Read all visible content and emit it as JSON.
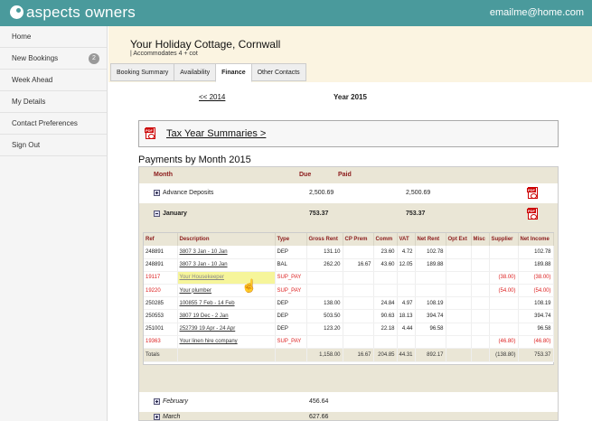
{
  "app": {
    "brand": "aspects owners",
    "user_email": "emailme@home.com"
  },
  "sidebar": {
    "items": [
      {
        "label": "Home"
      },
      {
        "label": "New Bookings",
        "badge": "2"
      },
      {
        "label": "Week Ahead"
      },
      {
        "label": "My Details"
      },
      {
        "label": "Contact Preferences"
      },
      {
        "label": "Sign Out"
      }
    ]
  },
  "property": {
    "title": "Your Holiday Cottage, Cornwall",
    "subtitle": "| Accommodates 4 + cot"
  },
  "tabs": [
    {
      "label": "Booking Summary"
    },
    {
      "label": "Availability"
    },
    {
      "label": "Finance",
      "active": true
    },
    {
      "label": "Other Contacts"
    }
  ],
  "finance": {
    "prev_year_link": "<< 2014",
    "current_year": "Year 2015",
    "tax_link": "Tax Year Summaries >",
    "section_title": "Payments by Month 2015",
    "month_headers": {
      "month": "Month",
      "due": "Due",
      "paid": "Paid"
    },
    "advance": {
      "label": "Advance Deposits",
      "due": "2,500.69",
      "paid": "2,500.69"
    },
    "january": {
      "label": "January",
      "due": "753.37",
      "paid": "753.37"
    },
    "february": {
      "label": "February",
      "due": "456.64"
    },
    "march": {
      "label": "March",
      "due": "627.66"
    },
    "columns": [
      "Ref",
      "Description",
      "Type",
      "Gross Rent",
      "CP Prem",
      "Comm",
      "VAT",
      "Net Rent",
      "Opt Ext",
      "Misc",
      "Supplier",
      "Net Income"
    ],
    "rows": [
      {
        "ref": "248891",
        "desc": "3807 3 Jan - 10 Jan",
        "type": "DEP",
        "gross": "131.10",
        "cp": "",
        "comm": "23.60",
        "vat": "4.72",
        "net": "102.78",
        "opt": "",
        "misc": "",
        "supplier": "",
        "income": "102.78",
        "sup": false
      },
      {
        "ref": "248891",
        "desc": "3807 3 Jan - 10 Jan",
        "type": "BAL",
        "gross": "262.20",
        "cp": "16.67",
        "comm": "43.60",
        "vat": "12.05",
        "net": "189.88",
        "opt": "",
        "misc": "",
        "supplier": "",
        "income": "189.88",
        "sup": false
      },
      {
        "ref": "19117",
        "desc": "Your Housekeeper",
        "type": "SUP_PAY",
        "gross": "",
        "cp": "",
        "comm": "",
        "vat": "",
        "net": "",
        "opt": "",
        "misc": "",
        "supplier": "(38.00)",
        "income": "(38.00)",
        "sup": true,
        "highlight": true
      },
      {
        "ref": "19220",
        "desc": "Your plumber",
        "type": "SUP_PAY",
        "gross": "",
        "cp": "",
        "comm": "",
        "vat": "",
        "net": "",
        "opt": "",
        "misc": "",
        "supplier": "(54.00)",
        "income": "(54.00)",
        "sup": true
      },
      {
        "ref": "250285",
        "desc": "100855 7 Feb - 14 Feb",
        "type": "DEP",
        "gross": "138.00",
        "cp": "",
        "comm": "24.84",
        "vat": "4.97",
        "net": "108.19",
        "opt": "",
        "misc": "",
        "supplier": "",
        "income": "108.19",
        "sup": false
      },
      {
        "ref": "250553",
        "desc": "3807 19 Dec - 2 Jan",
        "type": "DEP",
        "gross": "503.50",
        "cp": "",
        "comm": "90.63",
        "vat": "18.13",
        "net": "394.74",
        "opt": "",
        "misc": "",
        "supplier": "",
        "income": "394.74",
        "sup": false
      },
      {
        "ref": "251001",
        "desc": "252739 19 Apr - 24 Apr",
        "type": "DEP",
        "gross": "123.20",
        "cp": "",
        "comm": "22.18",
        "vat": "4.44",
        "net": "96.58",
        "opt": "",
        "misc": "",
        "supplier": "",
        "income": "96.58",
        "sup": false
      },
      {
        "ref": "19363",
        "desc": "Your linen hire company",
        "type": "SUP_PAY",
        "gross": "",
        "cp": "",
        "comm": "",
        "vat": "",
        "net": "",
        "opt": "",
        "misc": "",
        "supplier": "(46.80)",
        "income": "(46.80)",
        "sup": true
      }
    ],
    "totals": {
      "label": "Totals",
      "gross": "1,158.00",
      "cp": "16.67",
      "comm": "204.85",
      "vat": "44.31",
      "net": "892.17",
      "opt": "",
      "misc": "",
      "supplier": "(138.80)",
      "income": "753.37"
    }
  },
  "colors": {
    "topbar": "#4a9a9c",
    "header_bg": "#fbf4e1",
    "sup_red": "#dd2222",
    "table_bg": "#eae6d6"
  }
}
